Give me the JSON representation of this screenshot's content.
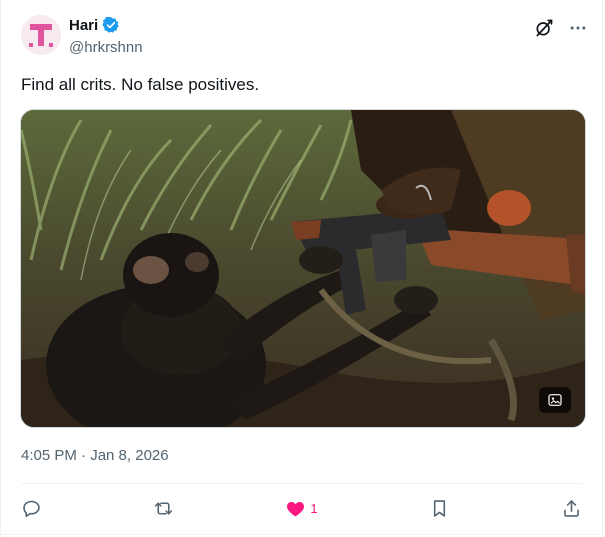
{
  "author": {
    "display_name": "Hari",
    "handle": "@hrkrshnn",
    "avatar_letter": "T",
    "verified": true
  },
  "post": {
    "text": "Find all crits. No false positives.",
    "timestamp": "4:05 PM · Jan 8, 2026"
  },
  "media": {
    "icons": [
      "alt-text-badge-icon"
    ]
  },
  "top_icons": [
    "grok-icon",
    "more-options-icon"
  ],
  "actions": {
    "reply": {
      "icon": "reply-icon"
    },
    "repost": {
      "icon": "repost-icon"
    },
    "like": {
      "icon": "heart-icon",
      "count": "1",
      "color": "#f91880"
    },
    "bookmark": {
      "icon": "bookmark-icon"
    },
    "share": {
      "icon": "share-icon"
    }
  },
  "colors": {
    "text_primary": "#0f1419",
    "text_secondary": "#536471",
    "verified_blue": "#1d9bf0",
    "like_pink": "#f91880",
    "avatar_pink": "#e0559e"
  }
}
